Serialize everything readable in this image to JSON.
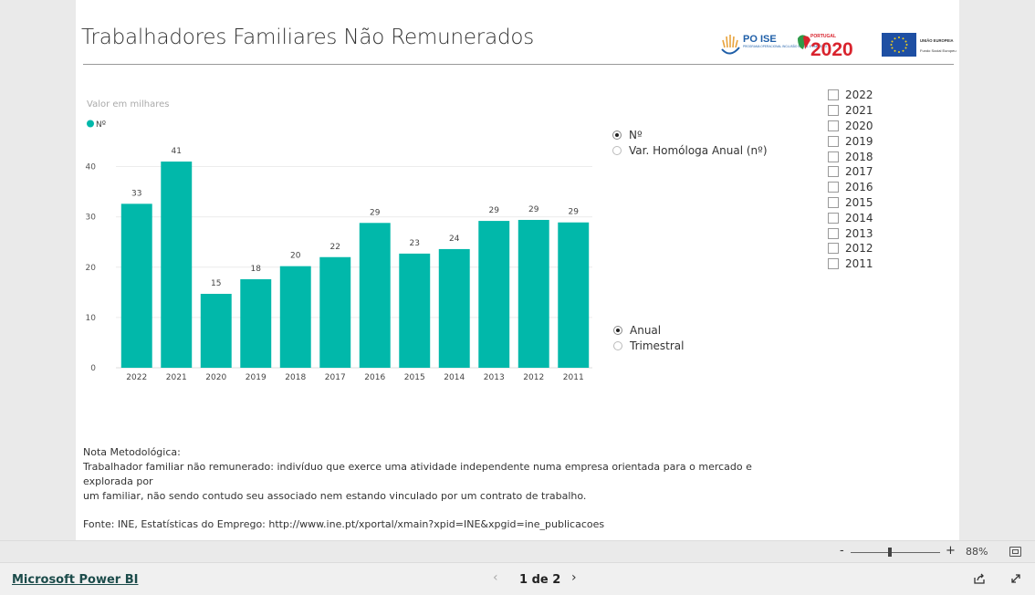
{
  "report": {
    "title": "Trabalhadores Familiares Não Remunerados",
    "logos": {
      "poise_label": "PO ISE",
      "poise_sub": "PROGRAMA OPERACIONAL INCLUSÃO SOCIAL E EMPREGO",
      "portugal_label": "PORTUGAL",
      "portugal_year": "2020",
      "eu_label": "UNIÃO EUROPEIA",
      "eu_sub": "Fundo Social Europeu"
    }
  },
  "chart_data": {
    "type": "bar",
    "ylabel": "Valor em milhares",
    "legend": "Nº",
    "categories": [
      "2022",
      "2021",
      "2020",
      "2019",
      "2018",
      "2017",
      "2016",
      "2015",
      "2014",
      "2013",
      "2012",
      "2011"
    ],
    "values": [
      32.6,
      41.0,
      14.7,
      17.6,
      20.2,
      22.0,
      28.8,
      22.7,
      23.6,
      29.2,
      29.4,
      28.9
    ],
    "labels": [
      "33",
      "41",
      "15",
      "18",
      "20",
      "22",
      "29",
      "23",
      "24",
      "29",
      "29",
      "29"
    ],
    "yticks": [
      "0",
      "10",
      "20",
      "30",
      "40"
    ],
    "ylim": [
      0,
      45
    ],
    "grid": true,
    "legend_position": "top-left",
    "bar_color": "#01b8aa"
  },
  "measure_options": [
    {
      "label": "Nº",
      "checked": true
    },
    {
      "label": "Var. Homóloga Anual (nº)",
      "checked": false
    }
  ],
  "period_options": [
    {
      "label": "Anual",
      "checked": true
    },
    {
      "label": "Trimestral",
      "checked": false
    }
  ],
  "year_filters": [
    "2022",
    "2021",
    "2020",
    "2019",
    "2018",
    "2017",
    "2016",
    "2015",
    "2014",
    "2013",
    "2012",
    "2011"
  ],
  "note": {
    "heading": "Nota Metodológica:",
    "line1": "Trabalhador familiar não remunerado: indivíduo que exerce uma atividade independente numa empresa orientada para o mercado e explorada por",
    "line2": "um familiar, não sendo contudo seu associado nem estando vinculado por um contrato de trabalho."
  },
  "source": "Fonte: INE,  Estatísticas do Emprego: http://www.ine.pt/xportal/xmain?xpid=INE&xpgid=ine_publicacoes",
  "zoom": {
    "minus": "-",
    "plus": "+",
    "level": "88%"
  },
  "footer": {
    "brand_link": "Microsoft Power BI",
    "page_indicator": "1 de 2",
    "prev": "‹",
    "next": "›"
  },
  "colors": {
    "accent": "#01b8aa",
    "brand_link": "#1b4b4a"
  }
}
